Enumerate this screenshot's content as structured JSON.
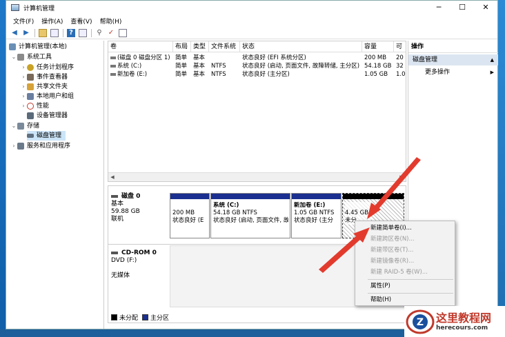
{
  "window": {
    "title": "计算机管理",
    "minimize": "─",
    "maximize": "☐",
    "close": "✕"
  },
  "menu": [
    "文件(F)",
    "操作(A)",
    "查看(V)",
    "帮助(H)"
  ],
  "tree": [
    {
      "label": "计算机管理(本地)",
      "exp": "",
      "icon_color": "#6a8fb5"
    },
    {
      "label": "系统工具",
      "exp": "⌄",
      "icon_color": "#8a8a8a"
    },
    {
      "label": "任务计划程序",
      "exp": "›",
      "icon_color": "#c9a227"
    },
    {
      "label": "事件查看器",
      "exp": "›",
      "icon_color": "#7a6a5a"
    },
    {
      "label": "共享文件夹",
      "exp": "›",
      "icon_color": "#d6a23a"
    },
    {
      "label": "本地用户和组",
      "exp": "›",
      "icon_color": "#6a7fa0"
    },
    {
      "label": "性能",
      "exp": "›",
      "icon_color": "#c0392b"
    },
    {
      "label": "设备管理器",
      "exp": "",
      "icon_color": "#5a6a7a"
    },
    {
      "label": "存储",
      "exp": "⌄",
      "icon_color": "#7a8a9a"
    },
    {
      "label": "磁盘管理",
      "exp": "",
      "icon_color": "#5f6f7f"
    },
    {
      "label": "服务和应用程序",
      "exp": "›",
      "icon_color": "#6a7a8a"
    }
  ],
  "volume_table": {
    "headers": [
      "卷",
      "布局",
      "类型",
      "文件系统",
      "状态",
      "容量",
      "可"
    ],
    "rows": [
      [
        "(磁盘 0 磁盘分区 1)",
        "简单",
        "基本",
        "",
        "状态良好 (EFI 系统分区)",
        "200 MB",
        "20"
      ],
      [
        "系统 (C:)",
        "简单",
        "基本",
        "NTFS",
        "状态良好 (启动, 页面文件, 故障转储, 主分区)",
        "54.18 GB",
        "32"
      ],
      [
        "新加卷 (E:)",
        "简单",
        "基本",
        "NTFS",
        "状态良好 (主分区)",
        "1.05 GB",
        "1.0"
      ]
    ]
  },
  "disk0": {
    "name": "磁盘 0",
    "type": "基本",
    "size": "59.88 GB",
    "status": "联机",
    "partitions": [
      {
        "title": "",
        "size": "200 MB",
        "status": "状态良好 (E"
      },
      {
        "title": "系统  (C:)",
        "size": "54.18 GB NTFS",
        "status": "状态良好 (启动, 页面文件, 故"
      },
      {
        "title": "新加卷  (E:)",
        "size": "1.05 GB NTFS",
        "status": "状态良好 (主分"
      },
      {
        "title": "",
        "size": "4.45 GB",
        "status": "未分"
      }
    ]
  },
  "cdrom": {
    "name": "CD-ROM 0",
    "drive": "DVD (F:)",
    "media": "无媒体"
  },
  "legend": {
    "unallocated": "未分配",
    "primary": "主分区"
  },
  "actions": {
    "header": "操作",
    "selected": "磁盘管理",
    "more": "更多操作"
  },
  "context_menu": {
    "items": [
      {
        "label": "新建简单卷(I)...",
        "enabled": true
      },
      {
        "label": "新建跨区卷(N)...",
        "enabled": false
      },
      {
        "label": "新建带区卷(T)...",
        "enabled": false
      },
      {
        "label": "新建镜像卷(R)...",
        "enabled": false
      },
      {
        "label": "新建 RAID-5 卷(W)...",
        "enabled": false
      },
      {
        "label": "属性(P)",
        "enabled": true
      },
      {
        "label": "帮助(H)",
        "enabled": true
      }
    ]
  },
  "watermark": {
    "name": "这里教程网",
    "url": "herecours.com"
  },
  "colors": {
    "primary_partition": "#1a2f8f",
    "unallocated": "#000000",
    "selection": "#cce4f7",
    "arrow": "#e23b2e"
  }
}
